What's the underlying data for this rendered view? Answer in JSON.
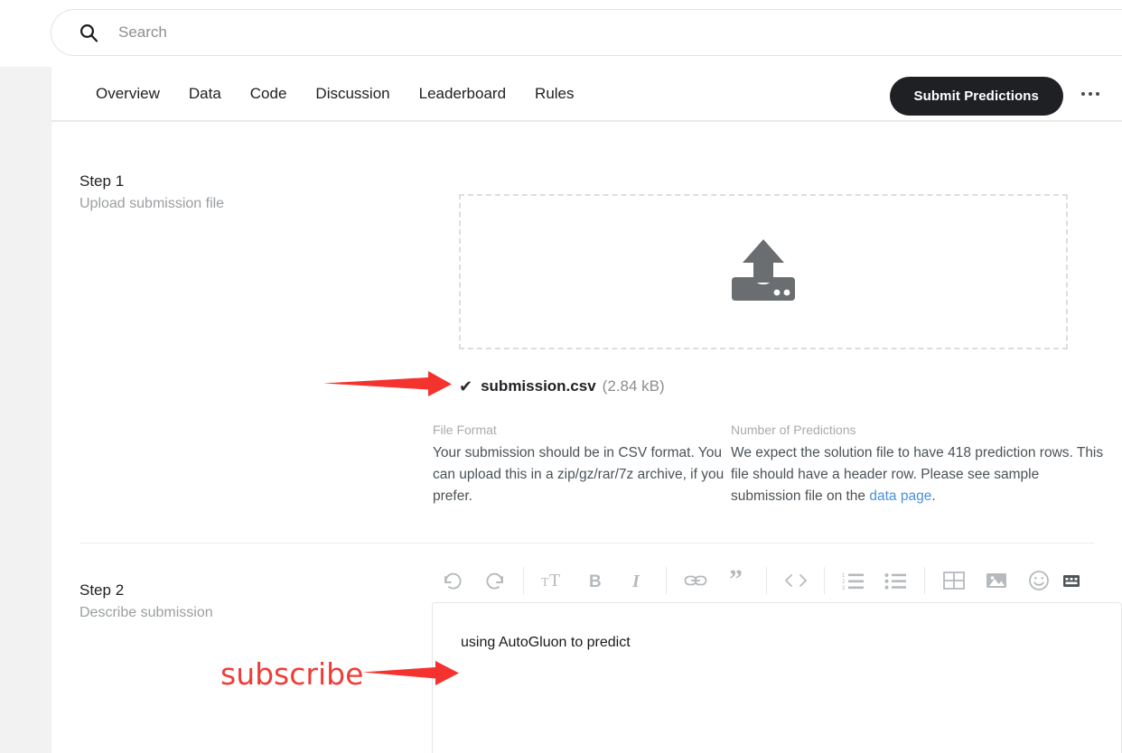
{
  "search": {
    "placeholder": "Search",
    "icon": "search-icon"
  },
  "nav": {
    "tabs": [
      {
        "label": "Overview"
      },
      {
        "label": "Data"
      },
      {
        "label": "Code"
      },
      {
        "label": "Discussion"
      },
      {
        "label": "Leaderboard"
      },
      {
        "label": "Rules"
      }
    ],
    "submit_label": "Submit Predictions",
    "more_icon": "kebab-menu-icon"
  },
  "step1": {
    "title": "Step 1",
    "subtitle": "Upload submission file",
    "dropzone_icon": "upload-icon",
    "file": {
      "check_icon": "check-icon",
      "name": "submission.csv",
      "size": "(2.84 kB)"
    },
    "info": [
      {
        "heading": "File Format",
        "body": "Your submission should be in CSV format. You can upload this in a zip/gz/rar/7z archive, if you prefer."
      },
      {
        "heading": "Number of Predictions",
        "body_before": "We expect the solution file to have 418 prediction rows. This file should have a header row. Please see sample submission file on the ",
        "link": "data page",
        "body_after": "."
      }
    ]
  },
  "step2": {
    "title": "Step 2",
    "subtitle": "Describe submission",
    "toolbar": [
      {
        "name": "undo-icon"
      },
      {
        "name": "redo-icon"
      },
      {
        "name": "font-size-icon"
      },
      {
        "name": "bold-icon"
      },
      {
        "name": "italic-icon"
      },
      {
        "name": "link-icon"
      },
      {
        "name": "quote-icon"
      },
      {
        "name": "code-icon"
      },
      {
        "name": "numbered-list-icon"
      },
      {
        "name": "bullet-list-icon"
      },
      {
        "name": "table-icon"
      },
      {
        "name": "image-icon"
      },
      {
        "name": "emoji-icon"
      },
      {
        "name": "keyboard-icon"
      }
    ],
    "editor_value": "using AutoGluon to predict"
  },
  "annotations": {
    "subscribe_label": "subscribe",
    "color": "#f03c36"
  }
}
